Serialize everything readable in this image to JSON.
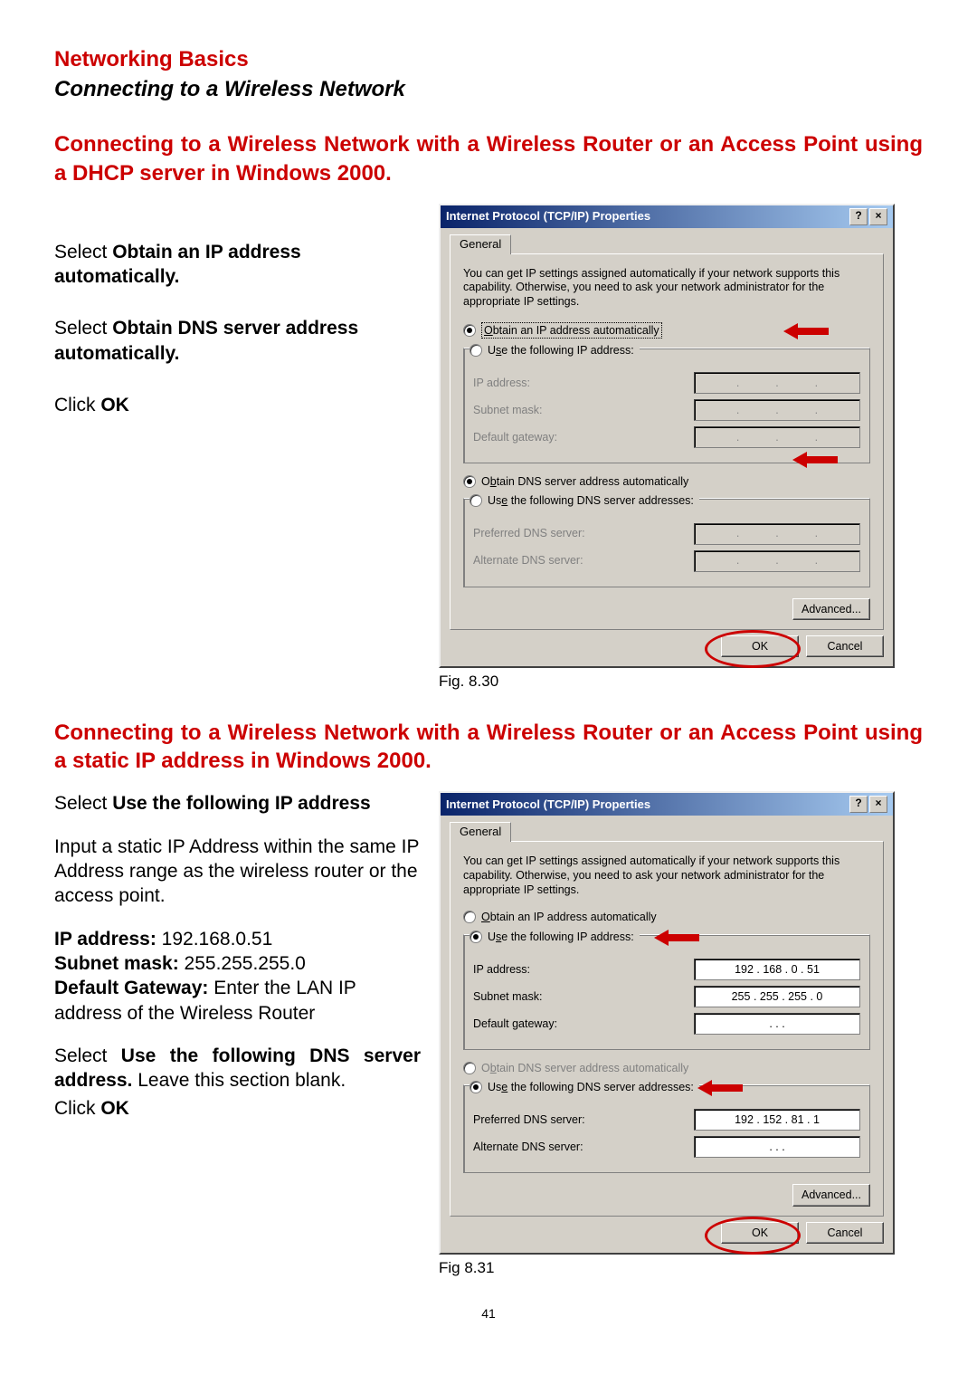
{
  "doc": {
    "title": "Networking Basics",
    "subtitle": "Connecting to a Wireless Network",
    "page_number": "41"
  },
  "section1": {
    "heading": "Connecting to a Wireless Network with a Wireless Router or an Access Point using a DHCP server in Windows 2000.",
    "step1_a": "Select ",
    "step1_b": "Obtain an IP address automatically.",
    "step2_a": "Select ",
    "step2_b": "Obtain DNS server address automatically.",
    "step3_a": "Click ",
    "step3_b": "OK",
    "fig": "Fig. 8.30"
  },
  "section2": {
    "heading": "Connecting to a Wireless Network with a Wireless Router or an Access Point using a static IP address in Windows 2000.",
    "p1_a": "Select ",
    "p1_b": "Use the following IP address",
    "p2": "Input a static IP Address within the same IP Address range as the wireless router or the access point.",
    "p3_a": "IP address: ",
    "p3_b": "192.168.0.51",
    "p4_a": "Subnet mask: ",
    "p4_b": "255.255.255.0",
    "p5_a": "Default Gateway: ",
    "p5_b": "Enter the LAN IP address of the Wireless Router",
    "p6_a": "Select ",
    "p6_b": "Use the following DNS server address.",
    "p6_c": " Leave this section blank.",
    "p7_a": "Click ",
    "p7_b": "OK",
    "fig": "Fig 8.31"
  },
  "dialog": {
    "title": "Internet Protocol (TCP/IP) Properties",
    "help_btn": "?",
    "close_btn": "×",
    "tab": "General",
    "info": "You can get IP settings assigned automatically if your network supports this capability. Otherwise, you need to ask your network administrator for the appropriate IP settings.",
    "opt_obtain_ip": "Obtain an IP address automatically",
    "opt_use_ip": "Use the following IP address:",
    "lbl_ip": "IP address:",
    "lbl_subnet": "Subnet mask:",
    "lbl_gateway": "Default gateway:",
    "opt_obtain_dns": "Obtain DNS server address automatically",
    "opt_use_dns": "Use the following DNS server addresses:",
    "lbl_pref_dns": "Preferred DNS server:",
    "lbl_alt_dns": "Alternate DNS server:",
    "advanced": "Advanced...",
    "ok": "OK",
    "cancel": "Cancel"
  },
  "dialog2_values": {
    "ip": "192 . 168 .   0  .  51",
    "subnet": "255 . 255 . 255 .   0",
    "gateway": ".       .       .",
    "pref_dns": "192 . 152 .  81  .   1",
    "alt_dns": ".       .       ."
  }
}
